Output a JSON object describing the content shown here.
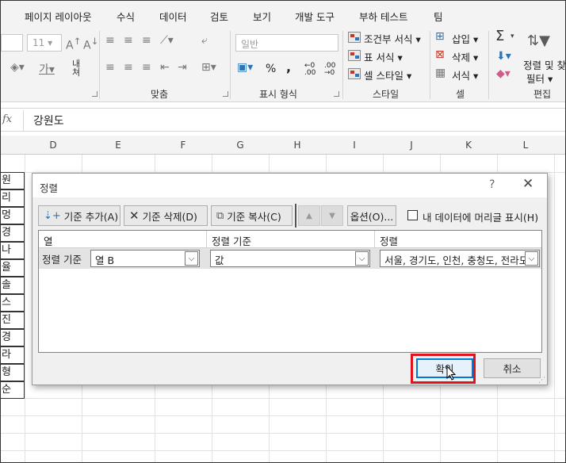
{
  "menu": {
    "tabs": [
      "페이지 레이아웃",
      "수식",
      "데이터",
      "검토",
      "보기",
      "개발 도구",
      "부하 테스트",
      "팀"
    ]
  },
  "ribbon": {
    "font_size": "11",
    "number_format": "일반",
    "percent_symbol": "%",
    "comma_symbol": ",",
    "inc_decimal": "←0 .00",
    "dec_decimal": ".00 →0",
    "wrap_label": "내\n쳐",
    "groups": {
      "alignment": "맞춤",
      "number": "표시 형식",
      "styles": "스타일",
      "cells": "셀",
      "editing": "편집"
    },
    "styles_items": [
      "조건부 서식",
      "표 서식",
      "셀 스타일"
    ],
    "cells_items": [
      "삽입",
      "삭제",
      "서식"
    ],
    "editing_items": {
      "sort_filter_line1": "정렬 및 찾",
      "sort_filter_line2": "필터",
      "sigma": "Σ"
    }
  },
  "formula_bar": {
    "fx": "fx",
    "value": "강원도"
  },
  "sheet": {
    "columns": [
      "D",
      "E",
      "F",
      "G",
      "H",
      "I",
      "J",
      "K",
      "L"
    ],
    "left_cells": [
      "원",
      "리",
      "멍",
      "경",
      "나",
      "율",
      "솔",
      "스",
      "진",
      "경",
      "라",
      "형",
      "순"
    ]
  },
  "dialog": {
    "title": "정렬",
    "help": "?",
    "close": "✕",
    "toolbar": {
      "add_level": "기준 추가(A)",
      "delete_level": "기준 삭제(D)",
      "copy_level": "기준 복사(C)",
      "move_up": "▲",
      "move_down": "▼",
      "options": "옵션(O)...",
      "header_checkbox_label": "내 데이터에 머리글 표시(H)"
    },
    "grid_headers": {
      "column": "열",
      "sort_on": "정렬 기준",
      "order": "정렬"
    },
    "row": {
      "label": "정렬 기준",
      "column_value": "열 B",
      "sort_on_value": "값",
      "order_value": "서울, 경기도, 인천, 충청도, 전라도"
    },
    "ok": "확인",
    "cancel": "취소"
  }
}
